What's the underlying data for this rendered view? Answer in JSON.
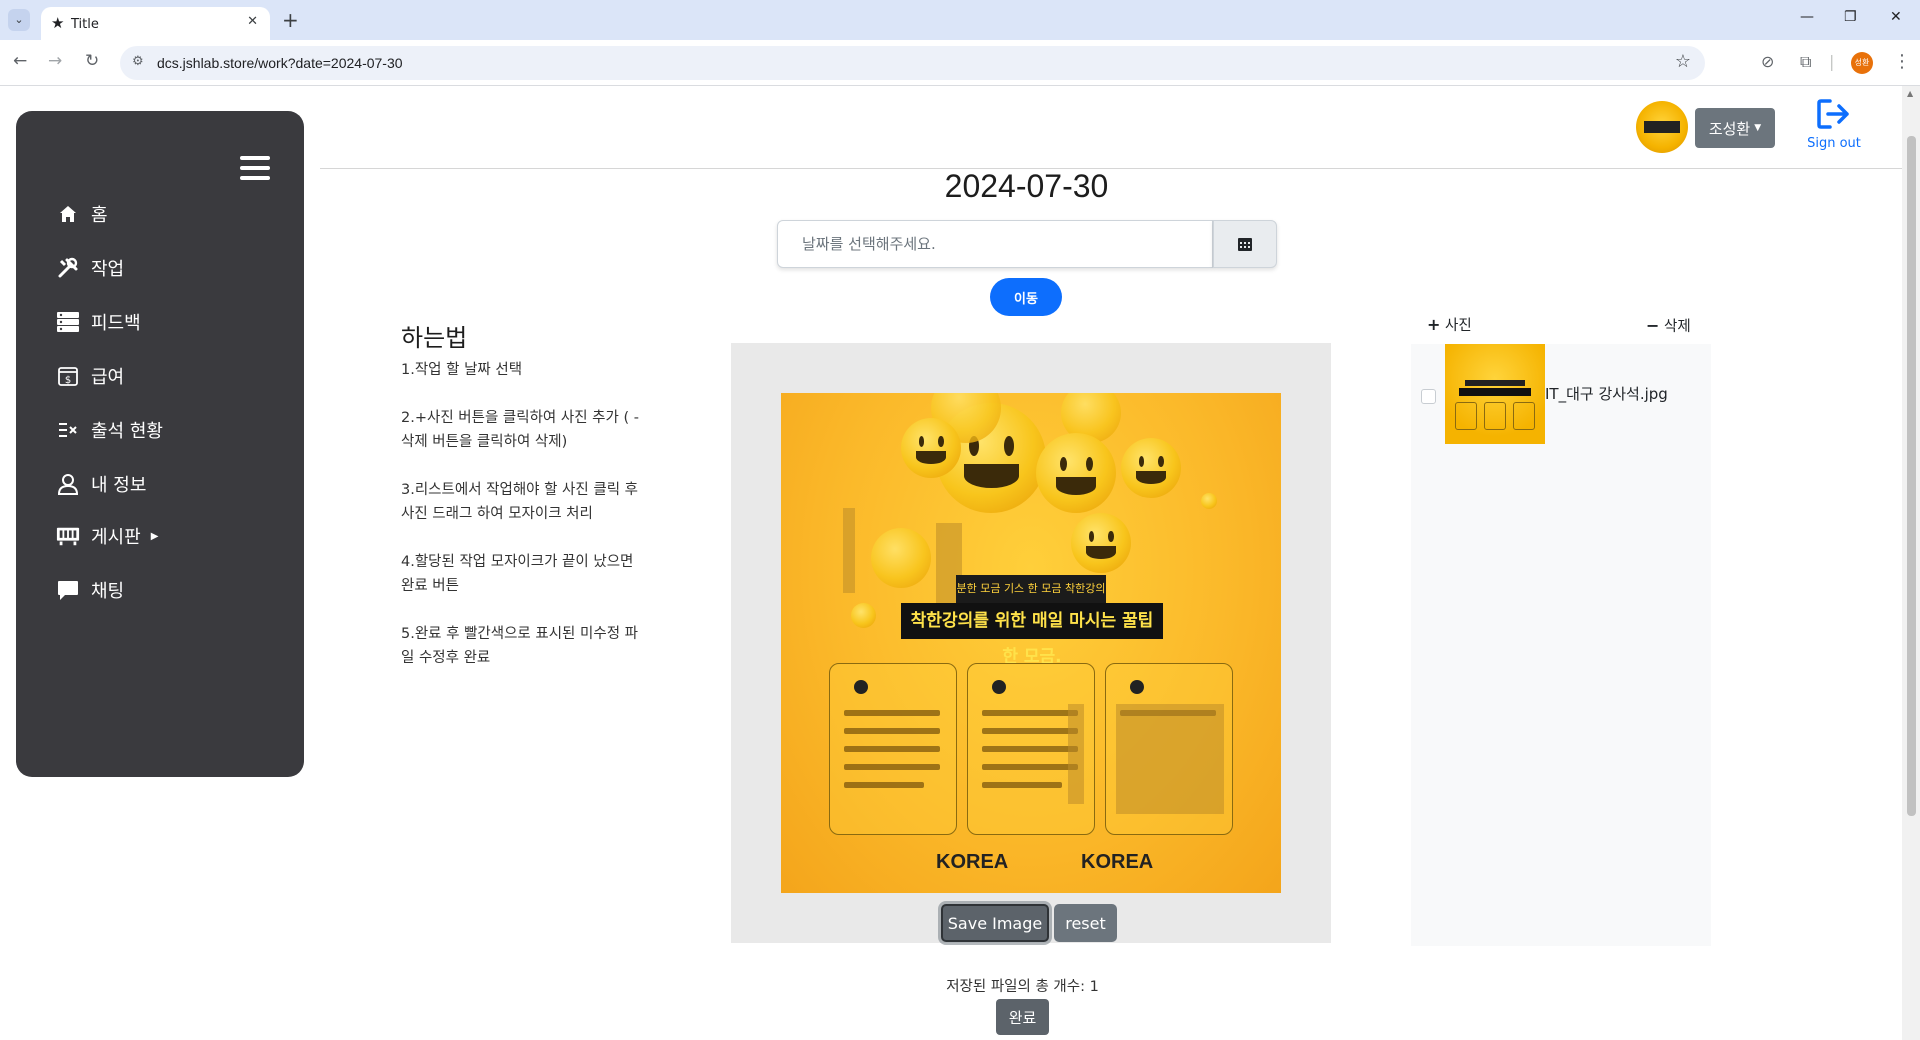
{
  "browser": {
    "tab_title": "Title",
    "url": "dcs.jshlab.store/work?date=2024-07-30",
    "profile_initials": "성환"
  },
  "sidebar": {
    "items": [
      {
        "label": "홈",
        "icon": "home-icon"
      },
      {
        "label": "작업",
        "icon": "tools-icon"
      },
      {
        "label": "피드백",
        "icon": "feedback-icon"
      },
      {
        "label": "급여",
        "icon": "salary-icon"
      },
      {
        "label": "출석 현황",
        "icon": "attendance-icon"
      },
      {
        "label": "내 정보",
        "icon": "user-icon"
      },
      {
        "label": "게시판",
        "icon": "board-icon"
      },
      {
        "label": "채팅",
        "icon": "chat-icon"
      }
    ]
  },
  "header": {
    "user_name": "조성환",
    "signout_label": "Sign out"
  },
  "main": {
    "date_title": "2024-07-30",
    "date_placeholder": "날짜를 선택해주세요.",
    "go_button": "이동",
    "howto_title": "하는법",
    "steps": [
      "1.작업 할 날짜 선택",
      "2.+사진 버튼을 클릭하여 사진 추가 ( -삭제 버튼을 클릭하여 삭제)",
      "3.리스트에서 작업해야 할 사진 클릭 후 사진 드래그 하여 모자이크 처리",
      "4.할당된 작업 모자이크가 끝이 났으면 완료 버튼",
      "5.완료 후 빨간색으로 표시된 미수정 파일 수정후 완료"
    ],
    "poster": {
      "banner_small": "분한 모금 기스 한 모금 착한강의 캠페인",
      "banner_big": "착한강의를 위한 매일 마시는 꿀팁 한 모금.",
      "logo_left": "KOREA",
      "logo_right": "KOREA"
    },
    "save_button": "Save Image",
    "reset_button": "reset",
    "file_count_text": "저장된 파일의 총 개수: 1",
    "done_button": "완료"
  },
  "files": {
    "add_label": "사진",
    "delete_label": "삭제",
    "items": [
      {
        "name": "IT_대구 강사석.jpg",
        "checked": false
      }
    ]
  },
  "colors": {
    "sidebar_bg": "#3a3a3e",
    "primary": "#0d6efd",
    "secondary": "#6c757d"
  }
}
